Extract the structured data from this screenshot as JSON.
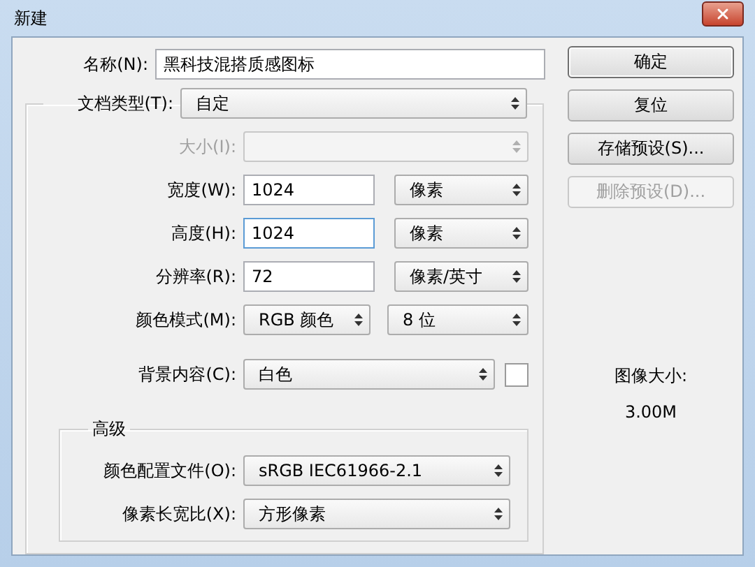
{
  "window": {
    "title": "新建"
  },
  "name": {
    "label": "名称(N):",
    "value": "黑科技混搭质感图标"
  },
  "document_type": {
    "label": "文档类型(T):",
    "value": "自定"
  },
  "rows": [
    {
      "label": "大小(I):",
      "disabled": true,
      "controls": [
        {
          "kind": "select",
          "focused": false
        }
      ]
    },
    {
      "label": "宽度(W):",
      "disabled": false,
      "controls": [
        {
          "kind": "input",
          "value": "1024",
          "focused": false
        },
        {
          "kind": "select",
          "value": "像素",
          "focused": false
        }
      ]
    },
    {
      "label": "高度(H):",
      "disabled": false,
      "controls": [
        {
          "kind": "input",
          "value": "1024",
          "focused": true
        },
        {
          "kind": "select",
          "value": "像素",
          "focused": false
        }
      ]
    },
    {
      "label": "分辨率(R):",
      "disabled": false,
      "controls": [
        {
          "kind": "input",
          "value": "72",
          "focused": false
        },
        {
          "kind": "select",
          "value": "像素/英寸",
          "focused": false
        }
      ]
    },
    {
      "label": "颜色模式(M):",
      "disabled": false,
      "controls": [
        {
          "kind": "select",
          "value": "RGB 颜色",
          "focused": false
        },
        {
          "kind": "select",
          "value": "8 位",
          "focused": false
        }
      ]
    },
    {
      "label": "背景内容(C):",
      "disabled": false,
      "controls": [
        {
          "kind": "select",
          "value": "白色",
          "focused": false
        },
        {
          "kind": "swatch",
          "focused": false
        }
      ]
    }
  ],
  "advanced": {
    "title": "高级",
    "rows": [
      {
        "label": "颜色配置文件(O):",
        "value": "sRGB IEC61966-2.1"
      },
      {
        "label": "像素长宽比(X):",
        "value": "方形像素"
      }
    ]
  },
  "buttons": [
    {
      "label": "确定",
      "default": true,
      "disabled": false
    },
    {
      "label": "复位",
      "default": false,
      "disabled": false
    },
    {
      "label": "存储预设(S)...",
      "default": false,
      "disabled": false
    },
    {
      "label": "删除预设(D)...",
      "default": false,
      "disabled": true
    }
  ],
  "image_size": {
    "label": "图像大小:",
    "value": "3.00M"
  }
}
